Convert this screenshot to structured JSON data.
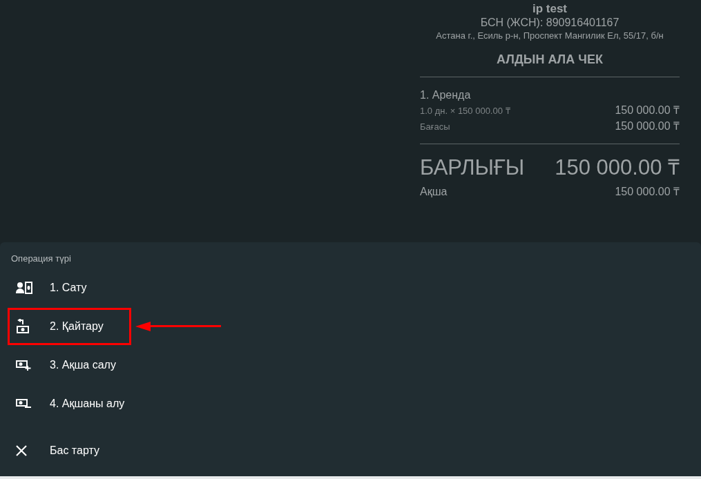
{
  "receipt": {
    "company": "ip test",
    "tax_id": "БСН (ЖСН): 890916401167",
    "address": "Астана г., Есиль р-н, Проспект Мангилик Ел, 55/17, б/н",
    "title": "АЛДЫН АЛА ЧЕК",
    "items": [
      {
        "name": "1. Аренда",
        "lines": [
          {
            "label": "1.0 дн. × 150 000.00 ₸",
            "amount": "150 000.00 ₸"
          },
          {
            "label": "Бағасы",
            "amount": "150 000.00 ₸"
          }
        ]
      }
    ],
    "total": {
      "label": "БАРЛЫҒЫ",
      "amount": "150 000.00 ₸"
    },
    "payments": [
      {
        "label": "Ақша",
        "amount": "150 000.00 ₸"
      }
    ]
  },
  "sheet": {
    "title": "Операция түрі",
    "options": [
      {
        "kind": "sale",
        "label": "1. Сату",
        "highlighted": false
      },
      {
        "kind": "return",
        "label": "2. Қайтару",
        "highlighted": true
      },
      {
        "kind": "deposit",
        "label": "3. Ақша салу",
        "highlighted": false
      },
      {
        "kind": "withdraw",
        "label": "4. Ақшаны алу",
        "highlighted": false
      },
      {
        "kind": "cancel",
        "label": "Бас тарту",
        "highlighted": false
      }
    ]
  }
}
